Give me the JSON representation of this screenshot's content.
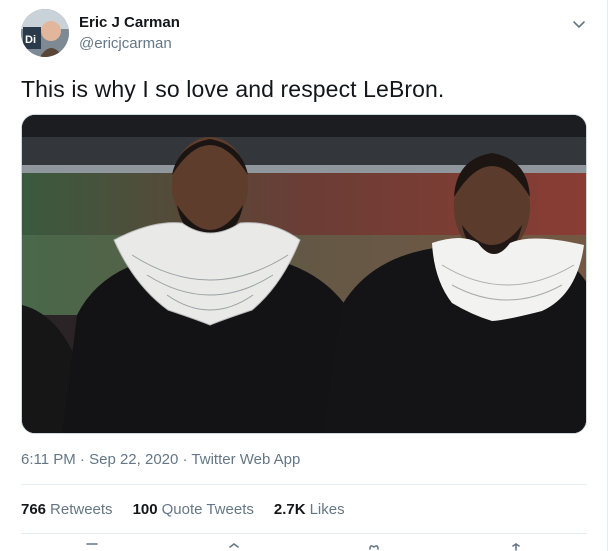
{
  "author": {
    "name": "Eric J Carman",
    "handle": "@ericjcarman"
  },
  "tweet": {
    "text": "This is why I so love and respect LeBron."
  },
  "timestamp": {
    "time": "6:11 PM",
    "separator1": " · ",
    "date": "Sep 22, 2020",
    "separator2": " · ",
    "source": "Twitter Web App"
  },
  "stats": {
    "retweets_count": "766",
    "retweets_label": "Retweets",
    "quotes_count": "100",
    "quotes_label": "Quote Tweets",
    "likes_count": "2.7K",
    "likes_label": "Likes"
  },
  "colors": {
    "text_primary": "#14171a",
    "text_secondary": "#657786",
    "divider": "#e6ecf0"
  },
  "icons": [
    "chevron-down-icon",
    "reply-icon",
    "retweet-icon",
    "like-icon",
    "share-icon"
  ]
}
